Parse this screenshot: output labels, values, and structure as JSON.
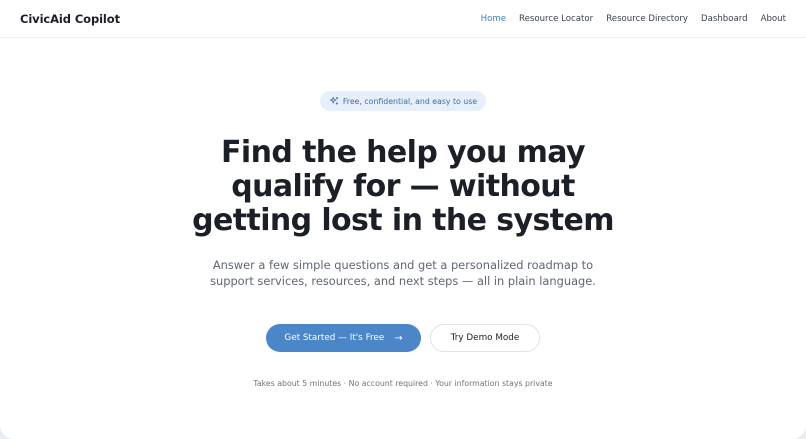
{
  "header": {
    "brand": "CivicAid Copilot",
    "nav": [
      {
        "label": "Home",
        "active": true
      },
      {
        "label": "Resource Locator",
        "active": false
      },
      {
        "label": "Resource Directory",
        "active": false
      },
      {
        "label": "Dashboard",
        "active": false
      },
      {
        "label": "About",
        "active": false
      }
    ]
  },
  "hero": {
    "badge": {
      "icon": "sparkles-icon",
      "text": "Free, confidential, and easy to use"
    },
    "headline": [
      "Find the help you may",
      "qualify for — without",
      "getting lost in the system"
    ],
    "subtext": [
      "Answer a few simple questions and get a personalized roadmap to",
      "support services, resources, and next steps — all in plain language."
    ],
    "primary_cta": "Get Started — It's Free",
    "primary_cta_icon": "arrow-right-icon",
    "secondary_cta": "Try Demo Mode",
    "footnote": "Takes about 5 minutes · No account required · Your information stays private"
  },
  "colors": {
    "accent": "#4a86c8",
    "nav_active": "#3f7fc1",
    "badge_bg": "#e7f0fa",
    "heading": "#1b1f27"
  }
}
